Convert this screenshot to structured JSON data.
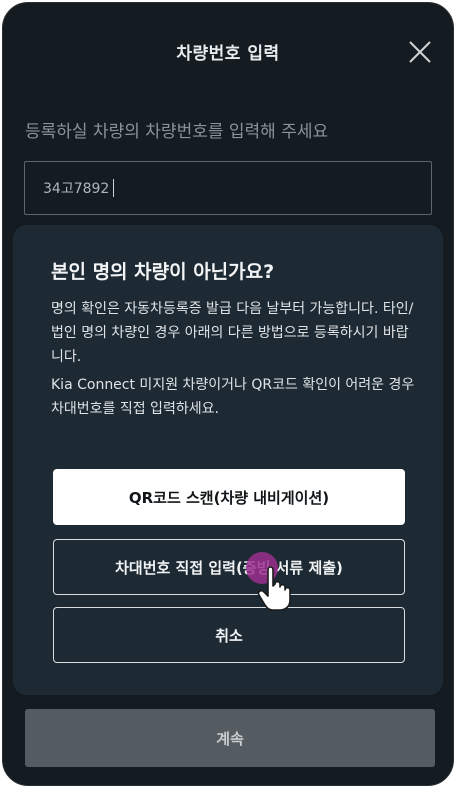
{
  "header": {
    "title": "차량번호 입력",
    "close_icon": "close-icon"
  },
  "instruction": "등록하실 차량의 차량번호를 입력해 주세요",
  "plate_input": {
    "value": "34고7892"
  },
  "dialog": {
    "title": "본인 명의 차량이 아닌가요?",
    "paragraph1": "명의 확인은 자동차등록증 발급 다음 날부터 가능합니다. 타인/법인 명의 차량인 경우 아래의 다른 방법으로 등록하시기 바랍니다.",
    "paragraph2": "Kia Connect 미지원 차량이거나 QR코드 확인이 어려운 경우 차대번호를 직접 입력하세요.",
    "qr_button": "QR코드 스캔(차량 내비게이션)",
    "direct_button": "차대번호 직접 입력(증빙 서류 제출)",
    "cancel_button": "취소"
  },
  "continue_button": "계속",
  "colors": {
    "background": "#141c22",
    "sheet": "#1d2a33",
    "accent_tap": "#9b2f8f"
  }
}
